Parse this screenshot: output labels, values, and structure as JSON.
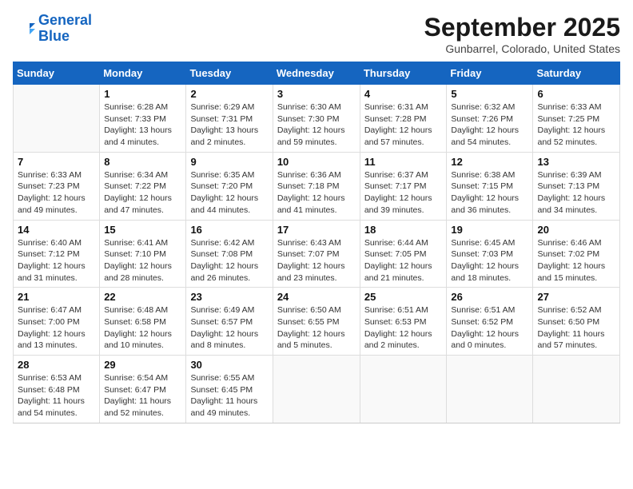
{
  "logo": {
    "line1": "General",
    "line2": "Blue"
  },
  "title": "September 2025",
  "location": "Gunbarrel, Colorado, United States",
  "days_of_week": [
    "Sunday",
    "Monday",
    "Tuesday",
    "Wednesday",
    "Thursday",
    "Friday",
    "Saturday"
  ],
  "weeks": [
    [
      {
        "num": "",
        "info": ""
      },
      {
        "num": "1",
        "info": "Sunrise: 6:28 AM\nSunset: 7:33 PM\nDaylight: 13 hours\nand 4 minutes."
      },
      {
        "num": "2",
        "info": "Sunrise: 6:29 AM\nSunset: 7:31 PM\nDaylight: 13 hours\nand 2 minutes."
      },
      {
        "num": "3",
        "info": "Sunrise: 6:30 AM\nSunset: 7:30 PM\nDaylight: 12 hours\nand 59 minutes."
      },
      {
        "num": "4",
        "info": "Sunrise: 6:31 AM\nSunset: 7:28 PM\nDaylight: 12 hours\nand 57 minutes."
      },
      {
        "num": "5",
        "info": "Sunrise: 6:32 AM\nSunset: 7:26 PM\nDaylight: 12 hours\nand 54 minutes."
      },
      {
        "num": "6",
        "info": "Sunrise: 6:33 AM\nSunset: 7:25 PM\nDaylight: 12 hours\nand 52 minutes."
      }
    ],
    [
      {
        "num": "7",
        "info": "Sunrise: 6:33 AM\nSunset: 7:23 PM\nDaylight: 12 hours\nand 49 minutes."
      },
      {
        "num": "8",
        "info": "Sunrise: 6:34 AM\nSunset: 7:22 PM\nDaylight: 12 hours\nand 47 minutes."
      },
      {
        "num": "9",
        "info": "Sunrise: 6:35 AM\nSunset: 7:20 PM\nDaylight: 12 hours\nand 44 minutes."
      },
      {
        "num": "10",
        "info": "Sunrise: 6:36 AM\nSunset: 7:18 PM\nDaylight: 12 hours\nand 41 minutes."
      },
      {
        "num": "11",
        "info": "Sunrise: 6:37 AM\nSunset: 7:17 PM\nDaylight: 12 hours\nand 39 minutes."
      },
      {
        "num": "12",
        "info": "Sunrise: 6:38 AM\nSunset: 7:15 PM\nDaylight: 12 hours\nand 36 minutes."
      },
      {
        "num": "13",
        "info": "Sunrise: 6:39 AM\nSunset: 7:13 PM\nDaylight: 12 hours\nand 34 minutes."
      }
    ],
    [
      {
        "num": "14",
        "info": "Sunrise: 6:40 AM\nSunset: 7:12 PM\nDaylight: 12 hours\nand 31 minutes."
      },
      {
        "num": "15",
        "info": "Sunrise: 6:41 AM\nSunset: 7:10 PM\nDaylight: 12 hours\nand 28 minutes."
      },
      {
        "num": "16",
        "info": "Sunrise: 6:42 AM\nSunset: 7:08 PM\nDaylight: 12 hours\nand 26 minutes."
      },
      {
        "num": "17",
        "info": "Sunrise: 6:43 AM\nSunset: 7:07 PM\nDaylight: 12 hours\nand 23 minutes."
      },
      {
        "num": "18",
        "info": "Sunrise: 6:44 AM\nSunset: 7:05 PM\nDaylight: 12 hours\nand 21 minutes."
      },
      {
        "num": "19",
        "info": "Sunrise: 6:45 AM\nSunset: 7:03 PM\nDaylight: 12 hours\nand 18 minutes."
      },
      {
        "num": "20",
        "info": "Sunrise: 6:46 AM\nSunset: 7:02 PM\nDaylight: 12 hours\nand 15 minutes."
      }
    ],
    [
      {
        "num": "21",
        "info": "Sunrise: 6:47 AM\nSunset: 7:00 PM\nDaylight: 12 hours\nand 13 minutes."
      },
      {
        "num": "22",
        "info": "Sunrise: 6:48 AM\nSunset: 6:58 PM\nDaylight: 12 hours\nand 10 minutes."
      },
      {
        "num": "23",
        "info": "Sunrise: 6:49 AM\nSunset: 6:57 PM\nDaylight: 12 hours\nand 8 minutes."
      },
      {
        "num": "24",
        "info": "Sunrise: 6:50 AM\nSunset: 6:55 PM\nDaylight: 12 hours\nand 5 minutes."
      },
      {
        "num": "25",
        "info": "Sunrise: 6:51 AM\nSunset: 6:53 PM\nDaylight: 12 hours\nand 2 minutes."
      },
      {
        "num": "26",
        "info": "Sunrise: 6:51 AM\nSunset: 6:52 PM\nDaylight: 12 hours\nand 0 minutes."
      },
      {
        "num": "27",
        "info": "Sunrise: 6:52 AM\nSunset: 6:50 PM\nDaylight: 11 hours\nand 57 minutes."
      }
    ],
    [
      {
        "num": "28",
        "info": "Sunrise: 6:53 AM\nSunset: 6:48 PM\nDaylight: 11 hours\nand 54 minutes."
      },
      {
        "num": "29",
        "info": "Sunrise: 6:54 AM\nSunset: 6:47 PM\nDaylight: 11 hours\nand 52 minutes."
      },
      {
        "num": "30",
        "info": "Sunrise: 6:55 AM\nSunset: 6:45 PM\nDaylight: 11 hours\nand 49 minutes."
      },
      {
        "num": "",
        "info": ""
      },
      {
        "num": "",
        "info": ""
      },
      {
        "num": "",
        "info": ""
      },
      {
        "num": "",
        "info": ""
      }
    ]
  ]
}
